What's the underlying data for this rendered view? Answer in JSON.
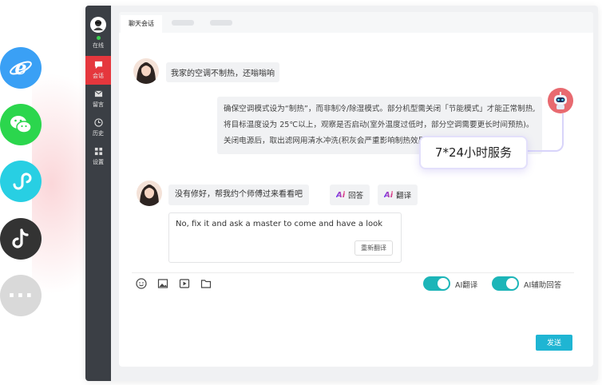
{
  "channels": [
    {
      "name": "ie-icon",
      "color": "#3aa0f5"
    },
    {
      "name": "wechat-icon",
      "color": "#2bd64d"
    },
    {
      "name": "mini-program-icon",
      "color": "#28cfe3"
    },
    {
      "name": "tiktok-icon",
      "color": "#333333"
    },
    {
      "name": "more-icon",
      "color": "#d9d9d9"
    }
  ],
  "sidebar": {
    "status": "在线",
    "items": [
      {
        "label": "会话",
        "icon": "chat-icon",
        "active": true
      },
      {
        "label": "留言",
        "icon": "mail-icon",
        "active": false
      },
      {
        "label": "历史",
        "icon": "clock-icon",
        "active": false
      },
      {
        "label": "设置",
        "icon": "grid-icon",
        "active": false
      }
    ]
  },
  "tabs": {
    "active": "聊天会话"
  },
  "messages": {
    "customer_1": "我家的空调不制热，还嗡嗡响",
    "agent_1": "确保空调模式设为“制热”，而非制冷/除湿模式。部分机型需关闭「节能模式」才能正常制热,将目标温度设为 25℃以上，观察是否启动(室外温度过低时，部分空调需要更长时间预热)。关闭电源后，取出滤网用清水冲洗(积灰会严重影响制热效果)",
    "customer_2": "没有修好，帮我约个师傅过来看看吧"
  },
  "actions": {
    "ai_mark": "Ai",
    "reply": "回答",
    "translate": "翻译"
  },
  "translation": {
    "text": "No, fix it and ask a master to come and have a look",
    "retranslate": "重新翻译"
  },
  "toolbar": {
    "icons": [
      "emoji-icon",
      "image-icon",
      "video-icon",
      "folder-icon"
    ],
    "ai_translate_label": "AI翻译",
    "ai_assist_label": "AI辅助回答",
    "ai_translate_on": true,
    "ai_assist_on": true
  },
  "send_label": "发送",
  "badge": "7*24小时服务",
  "colors": {
    "accent": "#1cb5b8",
    "sidebar": "#3b3f45",
    "active_nav": "#e5373d",
    "send": "#1fb5d3"
  }
}
